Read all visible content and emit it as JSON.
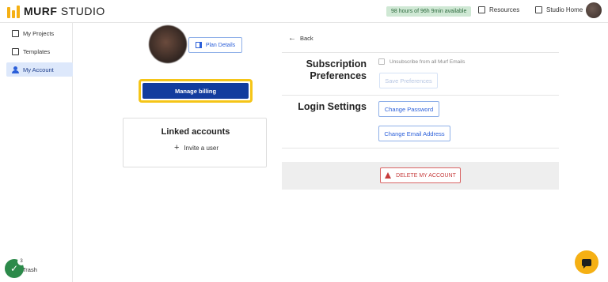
{
  "header": {
    "logo_bold": "MURF",
    "logo_rest": " STUDIO",
    "hours_badge": "98 hours of 96h 9min available",
    "resources_label": "Resources",
    "studio_home_label": "Studio Home"
  },
  "sidebar": {
    "items": [
      {
        "label": "My Projects",
        "icon": "projects-icon"
      },
      {
        "label": "Templates",
        "icon": "templates-icon"
      },
      {
        "label": "My Account",
        "icon": "user-icon",
        "active": true
      }
    ],
    "trash_label": "Trash",
    "task_count": "3"
  },
  "profile": {
    "plan_details_label": "Plan Details",
    "manage_billing_label": "Manage billing"
  },
  "linked_accounts": {
    "title": "Linked accounts",
    "invite_label": "Invite a user"
  },
  "settings": {
    "back_label": "Back",
    "subscription_title_line1": "Subscription",
    "subscription_title_line2": "Preferences",
    "unsubscribe_label": "Unsubscribe from all Murf Emails",
    "save_preferences_label": "Save Preferences",
    "login_title": "Login Settings",
    "change_password_label": "Change Password",
    "change_email_label": "Change Email Address",
    "delete_account_label": "DELETE MY ACCOUNT"
  },
  "colors": {
    "brand": "#f5b014",
    "primary": "#123c9e",
    "highlight": "#f5c518",
    "danger": "#c63c3c"
  }
}
